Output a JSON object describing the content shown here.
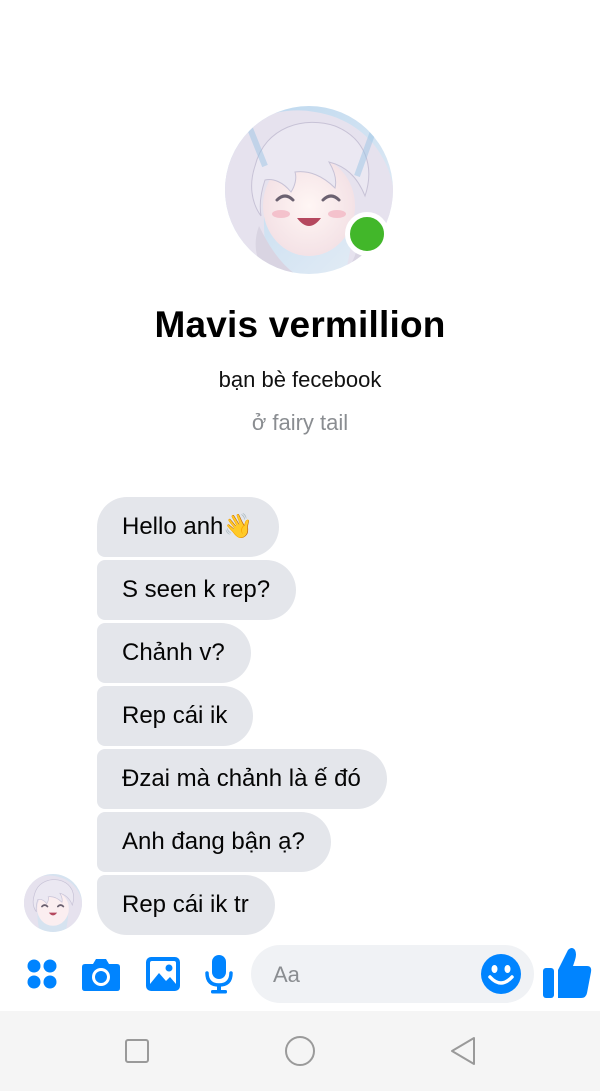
{
  "profile": {
    "name": "Mavis vermillion",
    "relation": "bạn bè fecebook",
    "location": "ở fairy tail",
    "online": true
  },
  "messages": [
    {
      "text": "Hello anh👋"
    },
    {
      "text": "S seen k rep?"
    },
    {
      "text": "Chảnh v?"
    },
    {
      "text": "Rep cái ik"
    },
    {
      "text": "Đzai mà chảnh là ế đó"
    },
    {
      "text": "Anh đang bận ạ?"
    },
    {
      "text": "Rep cái ik tr"
    }
  ],
  "composer": {
    "placeholder": "Aa",
    "tools": [
      "apps-icon",
      "camera-icon",
      "gallery-icon",
      "microphone-icon"
    ],
    "emoji_icon": "smiley-icon",
    "send_icon": "thumbs-up-icon"
  },
  "colors": {
    "accent": "#0084ff",
    "bubble": "#e4e6eb",
    "online": "#42b72a",
    "secondary_text": "#8a8d91",
    "navbar": "#f5f5f5"
  },
  "navbar": {
    "buttons": [
      "recent-apps-icon",
      "home-icon",
      "back-icon"
    ]
  }
}
